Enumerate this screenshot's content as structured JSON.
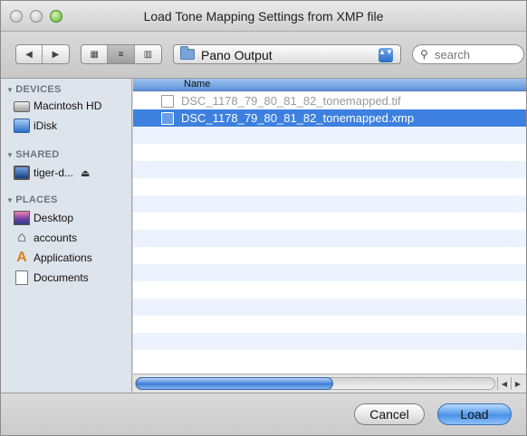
{
  "window": {
    "title": "Load Tone Mapping Settings from XMP file"
  },
  "toolbar": {
    "back_glyph": "◀",
    "forward_glyph": "▶",
    "icon_view_glyph": "▦",
    "list_view_glyph": "≡",
    "column_view_glyph": "▥",
    "location": "Pano Output",
    "stepper_glyph": "▲▼",
    "search_glyph": "⚲",
    "search_placeholder": "search"
  },
  "sidebar": {
    "devices_label": "DEVICES",
    "devices": [
      "Macintosh HD",
      "iDisk"
    ],
    "shared_label": "SHARED",
    "shared": [
      "tiger-d..."
    ],
    "eject_glyph": "⏏",
    "places_label": "PLACES",
    "places": [
      "Desktop",
      "accounts",
      "Applications",
      "Documents"
    ],
    "home_glyph": "⌂",
    "apps_glyph": "A"
  },
  "file_list": {
    "column_header": "Name",
    "files": [
      {
        "name": "DSC_1178_79_80_81_82_tonemapped.tif",
        "selected": false
      },
      {
        "name": "DSC_1178_79_80_81_82_tonemapped.xmp",
        "selected": true
      }
    ]
  },
  "scrollbar": {
    "left_glyph": "◀",
    "right_glyph": "▶",
    "position_fraction": 0
  },
  "buttons": {
    "cancel": "Cancel",
    "load": "Load"
  },
  "colors": {
    "selection": "#3d80df",
    "header": "#5f94db",
    "stripe": "#edf3fe"
  }
}
